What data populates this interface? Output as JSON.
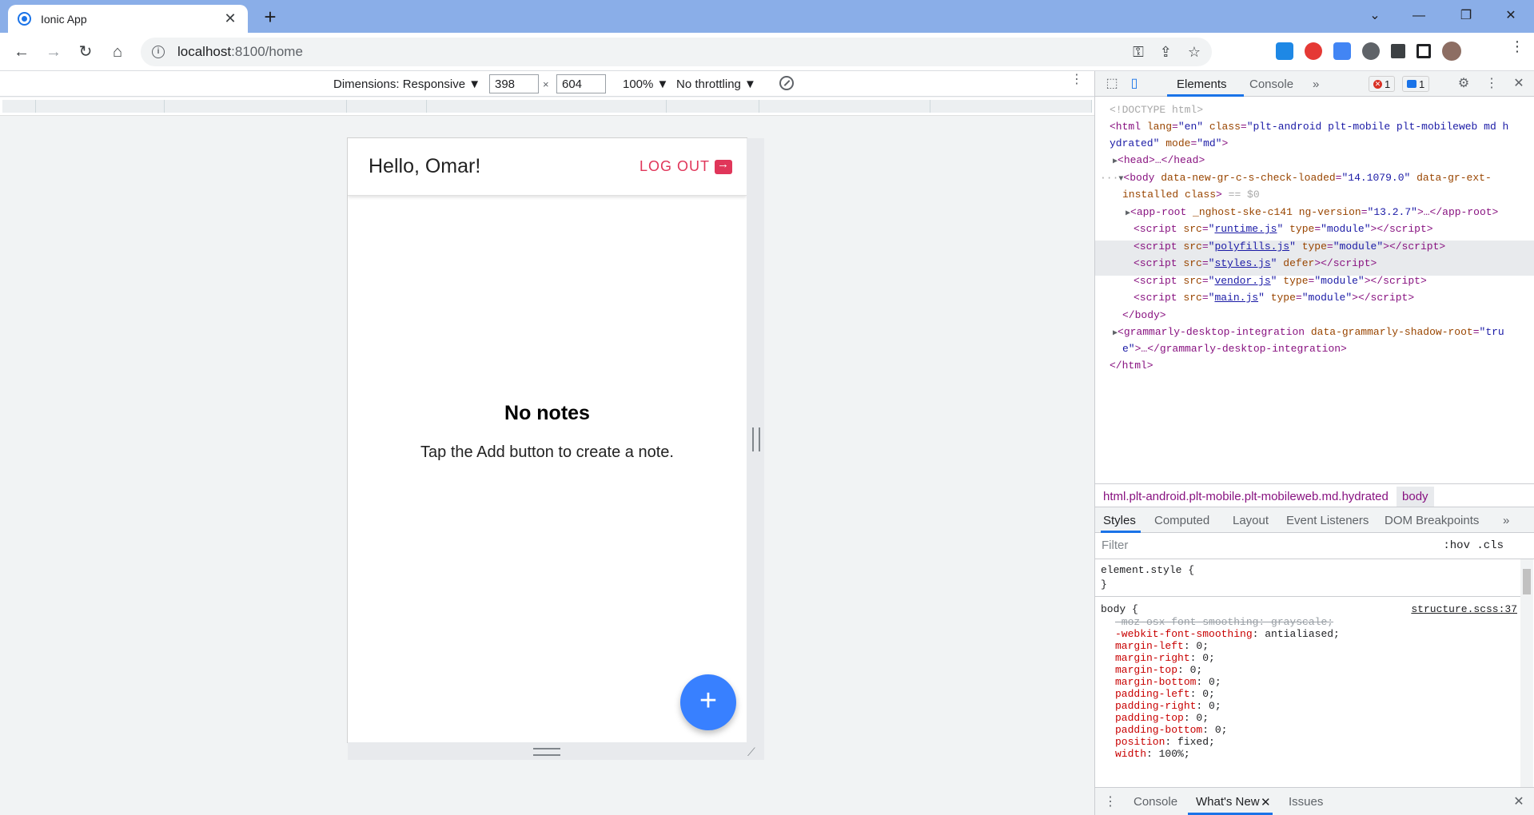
{
  "browser": {
    "tab_title": "Ionic App",
    "url_host": "localhost",
    "url_path": ":8100/home"
  },
  "device_toolbar": {
    "dimensions_label": "Dimensions: Responsive ▼",
    "width_value": "398",
    "height_value": "604",
    "zoom_label": "100% ▼",
    "throttle_label": "No throttling ▼"
  },
  "app": {
    "header_title": "Hello, Omar!",
    "logout_label": "LOG OUT",
    "empty_title": "No notes",
    "empty_text": "Tap the Add button to create a note.",
    "fab_label": "+"
  },
  "devtools": {
    "tabs": [
      "Elements",
      "Console",
      "»"
    ],
    "error_count": "1",
    "message_count": "1",
    "breadcrumb_path": "html.plt-android.plt-mobile.plt-mobileweb.md.hydrated",
    "breadcrumb_active": "body",
    "sub_tabs": [
      "Styles",
      "Computed",
      "Layout",
      "Event Listeners",
      "DOM Breakpoints",
      "»"
    ],
    "filter_placeholder": "Filter",
    "filter_tools": ":hov .cls",
    "drawer_tabs": [
      "Console",
      "What's New",
      "Issues"
    ],
    "style_source": "structure.scss:37"
  },
  "colors": {
    "accent_blue": "#3880ff",
    "logout_red": "#e0365a",
    "tab_strip": "#8aaee8"
  }
}
